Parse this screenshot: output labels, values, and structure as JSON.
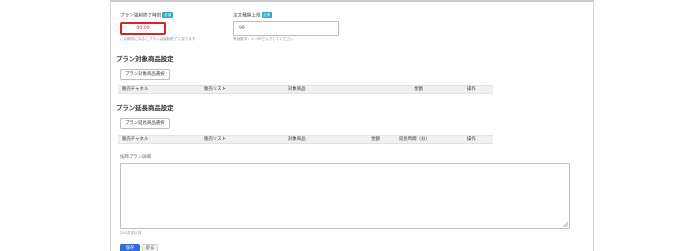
{
  "form": {
    "end_time": {
      "label": "プラン強制終了時刻",
      "required_badge": "必須",
      "value": "00:00",
      "hint": "この時刻になるとプランは強制終了になります"
    },
    "order_limit": {
      "label": "注文種類上限",
      "required_badge": "必須",
      "value": "99",
      "hint": "有効数字：1〜99で入力してください"
    }
  },
  "target_section": {
    "title": "プラン対象商品設定",
    "select_button": "プラン対象商品選択",
    "columns": [
      "販売チャネル",
      "販売リスト",
      "対象商品",
      "金額",
      "操作"
    ]
  },
  "extension_section": {
    "title": "プラン延長商品設定",
    "select_button": "プラン延長商品選択",
    "columns": [
      "販売チャネル",
      "販売リスト",
      "対象商品",
      "金額",
      "延長時間（分）",
      "操作"
    ]
  },
  "detail": {
    "label": "技師プラン詳細",
    "char_limit": "250文字以内"
  },
  "buttons": {
    "save": "保存",
    "cancel": "戻る"
  }
}
